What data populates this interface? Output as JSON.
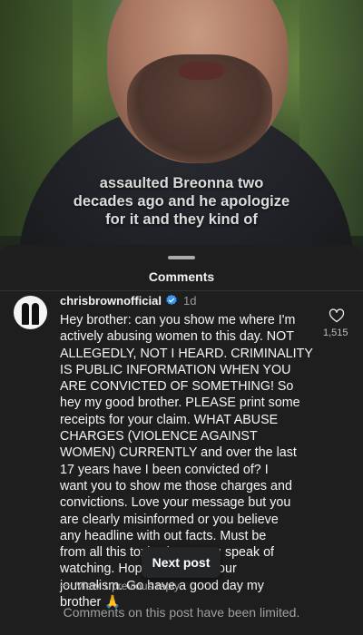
{
  "video": {
    "caption_lines": [
      "assaulted Breonna two",
      "decades ago and he apologize",
      "for it and they kind of"
    ]
  },
  "sheet": {
    "title": "Comments"
  },
  "comment": {
    "username": "chrisbrownofficial",
    "time": "1d",
    "text": "Hey brother: can you show me where I'm\nactively abusing women to this day. NOT\nALLEGEDLY, NOT I HEARD. CRIMINALITY\nIS PUBLIC INFORMATION WHEN YOU\nARE CONVICTED OF SOMETHING!  So\nhey my good brother. PLEASE print some\nreceipts for your claim. WHAT ABUSE\nCHARGES (VIOLENCE AGAINST\nWOMEN) CURRENTLY and over the last\n17 years have I been convicted of?  I\nwant you to show me those charges and\nconvictions. Love your message but you\nare clearly misinformed or you believe\nany headline with out facts. Must be\nfrom all this toxic shows you speak of\nwatching. Hope this helps your\njournalism. Go have a good day my\nbrother 🙏",
    "like_count": "1,515",
    "view_replies": "View 1 previous reply"
  },
  "next_post_label": "Next post",
  "limited_notice": "Comments on this post have been limited.",
  "colors": {
    "sheet_bg": "#1e1e1f",
    "verified_blue": "#3797f0"
  },
  "icons": {
    "like": "heart-outline-icon",
    "verified": "verified-badge-icon"
  }
}
